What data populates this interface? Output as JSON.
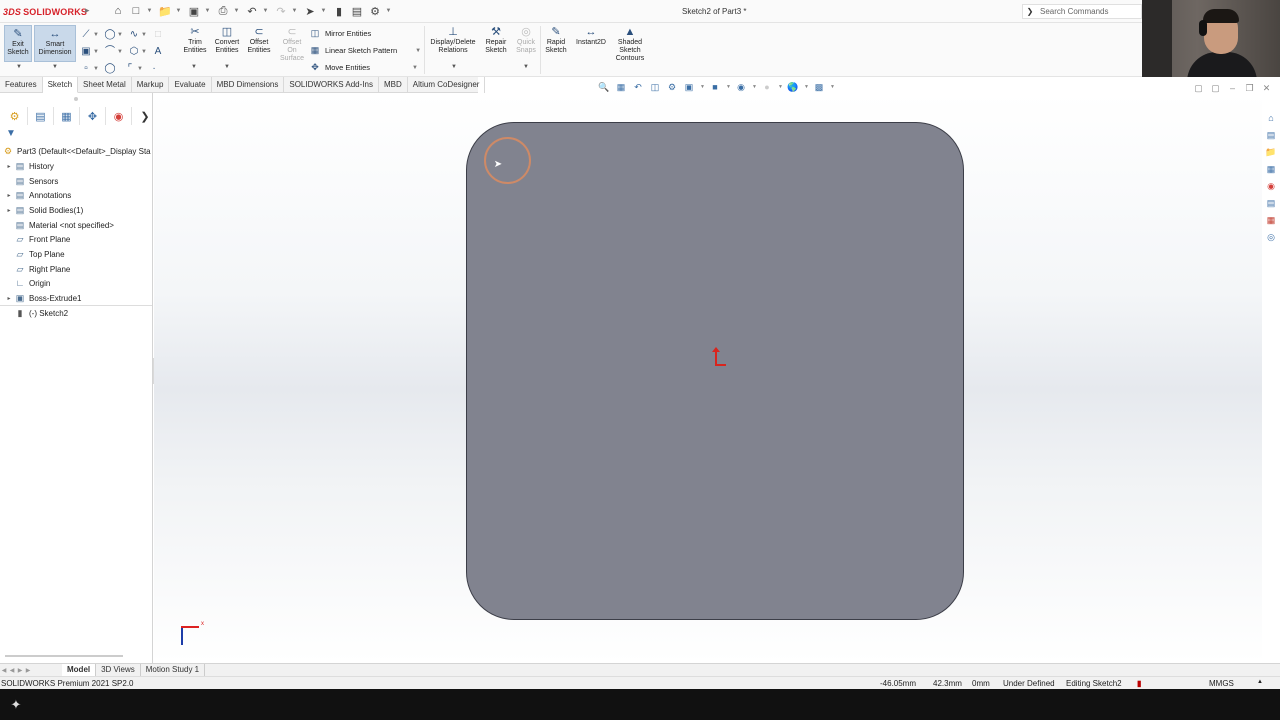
{
  "app": {
    "brand": "SOLIDWORKS",
    "doc_title": "Sketch2 of Part3 *"
  },
  "search": {
    "placeholder": "Search Commands"
  },
  "commands": {
    "exit_sketch": "Exit Sketch",
    "smart_dimension": "Smart Dimension",
    "trim_entities": "Trim Entities",
    "convert_entities": "Convert Entities",
    "offset_entities": "Offset Entities",
    "offset_on_surface": "Offset On Surface",
    "mirror_entities": "Mirror Entities",
    "linear_sketch_pattern": "Linear Sketch Pattern",
    "move_entities": "Move Entities",
    "display_delete_relations": "Display/Delete Relations",
    "repair_sketch": "Repair Sketch",
    "quick_snaps": "Quick Snaps",
    "rapid_sketch": "Rapid Sketch",
    "instant2d": "Instant2D",
    "shaded_sketch_contours": "Shaded Sketch Contours"
  },
  "tabs": [
    "Features",
    "Sketch",
    "Sheet Metal",
    "Markup",
    "Evaluate",
    "MBD Dimensions",
    "SOLIDWORKS Add-Ins",
    "MBD",
    "Altium CoDesigner"
  ],
  "active_tab": "Sketch",
  "tree": {
    "root": "Part3  (Default<<Default>_Display Sta",
    "items": [
      {
        "label": "History",
        "icon": "folder-icon",
        "expandable": true
      },
      {
        "label": "Sensors",
        "icon": "sensor-icon",
        "expandable": false
      },
      {
        "label": "Annotations",
        "icon": "annotations-icon",
        "expandable": true
      },
      {
        "label": "Solid Bodies(1)",
        "icon": "solid-bodies-icon",
        "expandable": true
      },
      {
        "label": "Material <not specified>",
        "icon": "material-icon",
        "expandable": false
      },
      {
        "label": "Front Plane",
        "icon": "plane-icon",
        "expandable": false
      },
      {
        "label": "Top Plane",
        "icon": "plane-icon",
        "expandable": false
      },
      {
        "label": "Right Plane",
        "icon": "plane-icon",
        "expandable": false
      },
      {
        "label": "Origin",
        "icon": "origin-icon",
        "expandable": false
      },
      {
        "label": "Boss-Extrude1",
        "icon": "extrude-icon",
        "expandable": true
      },
      {
        "label": "(-) Sketch2",
        "icon": "sketch-icon",
        "expandable": false
      }
    ]
  },
  "triad": {
    "x_label": "x"
  },
  "bottom_tabs": [
    "Model",
    "3D Views",
    "Motion Study 1"
  ],
  "status": {
    "product": "SOLIDWORKS Premium 2021 SP2.0",
    "x": "-46.05mm",
    "y": "42.3mm",
    "z": "0mm",
    "sketch_state": "Under Defined",
    "editing": "Editing Sketch2",
    "units": "MMGS"
  },
  "colors": {
    "part_face": "#81838f",
    "origin": "#d9251d",
    "brand": "#d6222a"
  }
}
